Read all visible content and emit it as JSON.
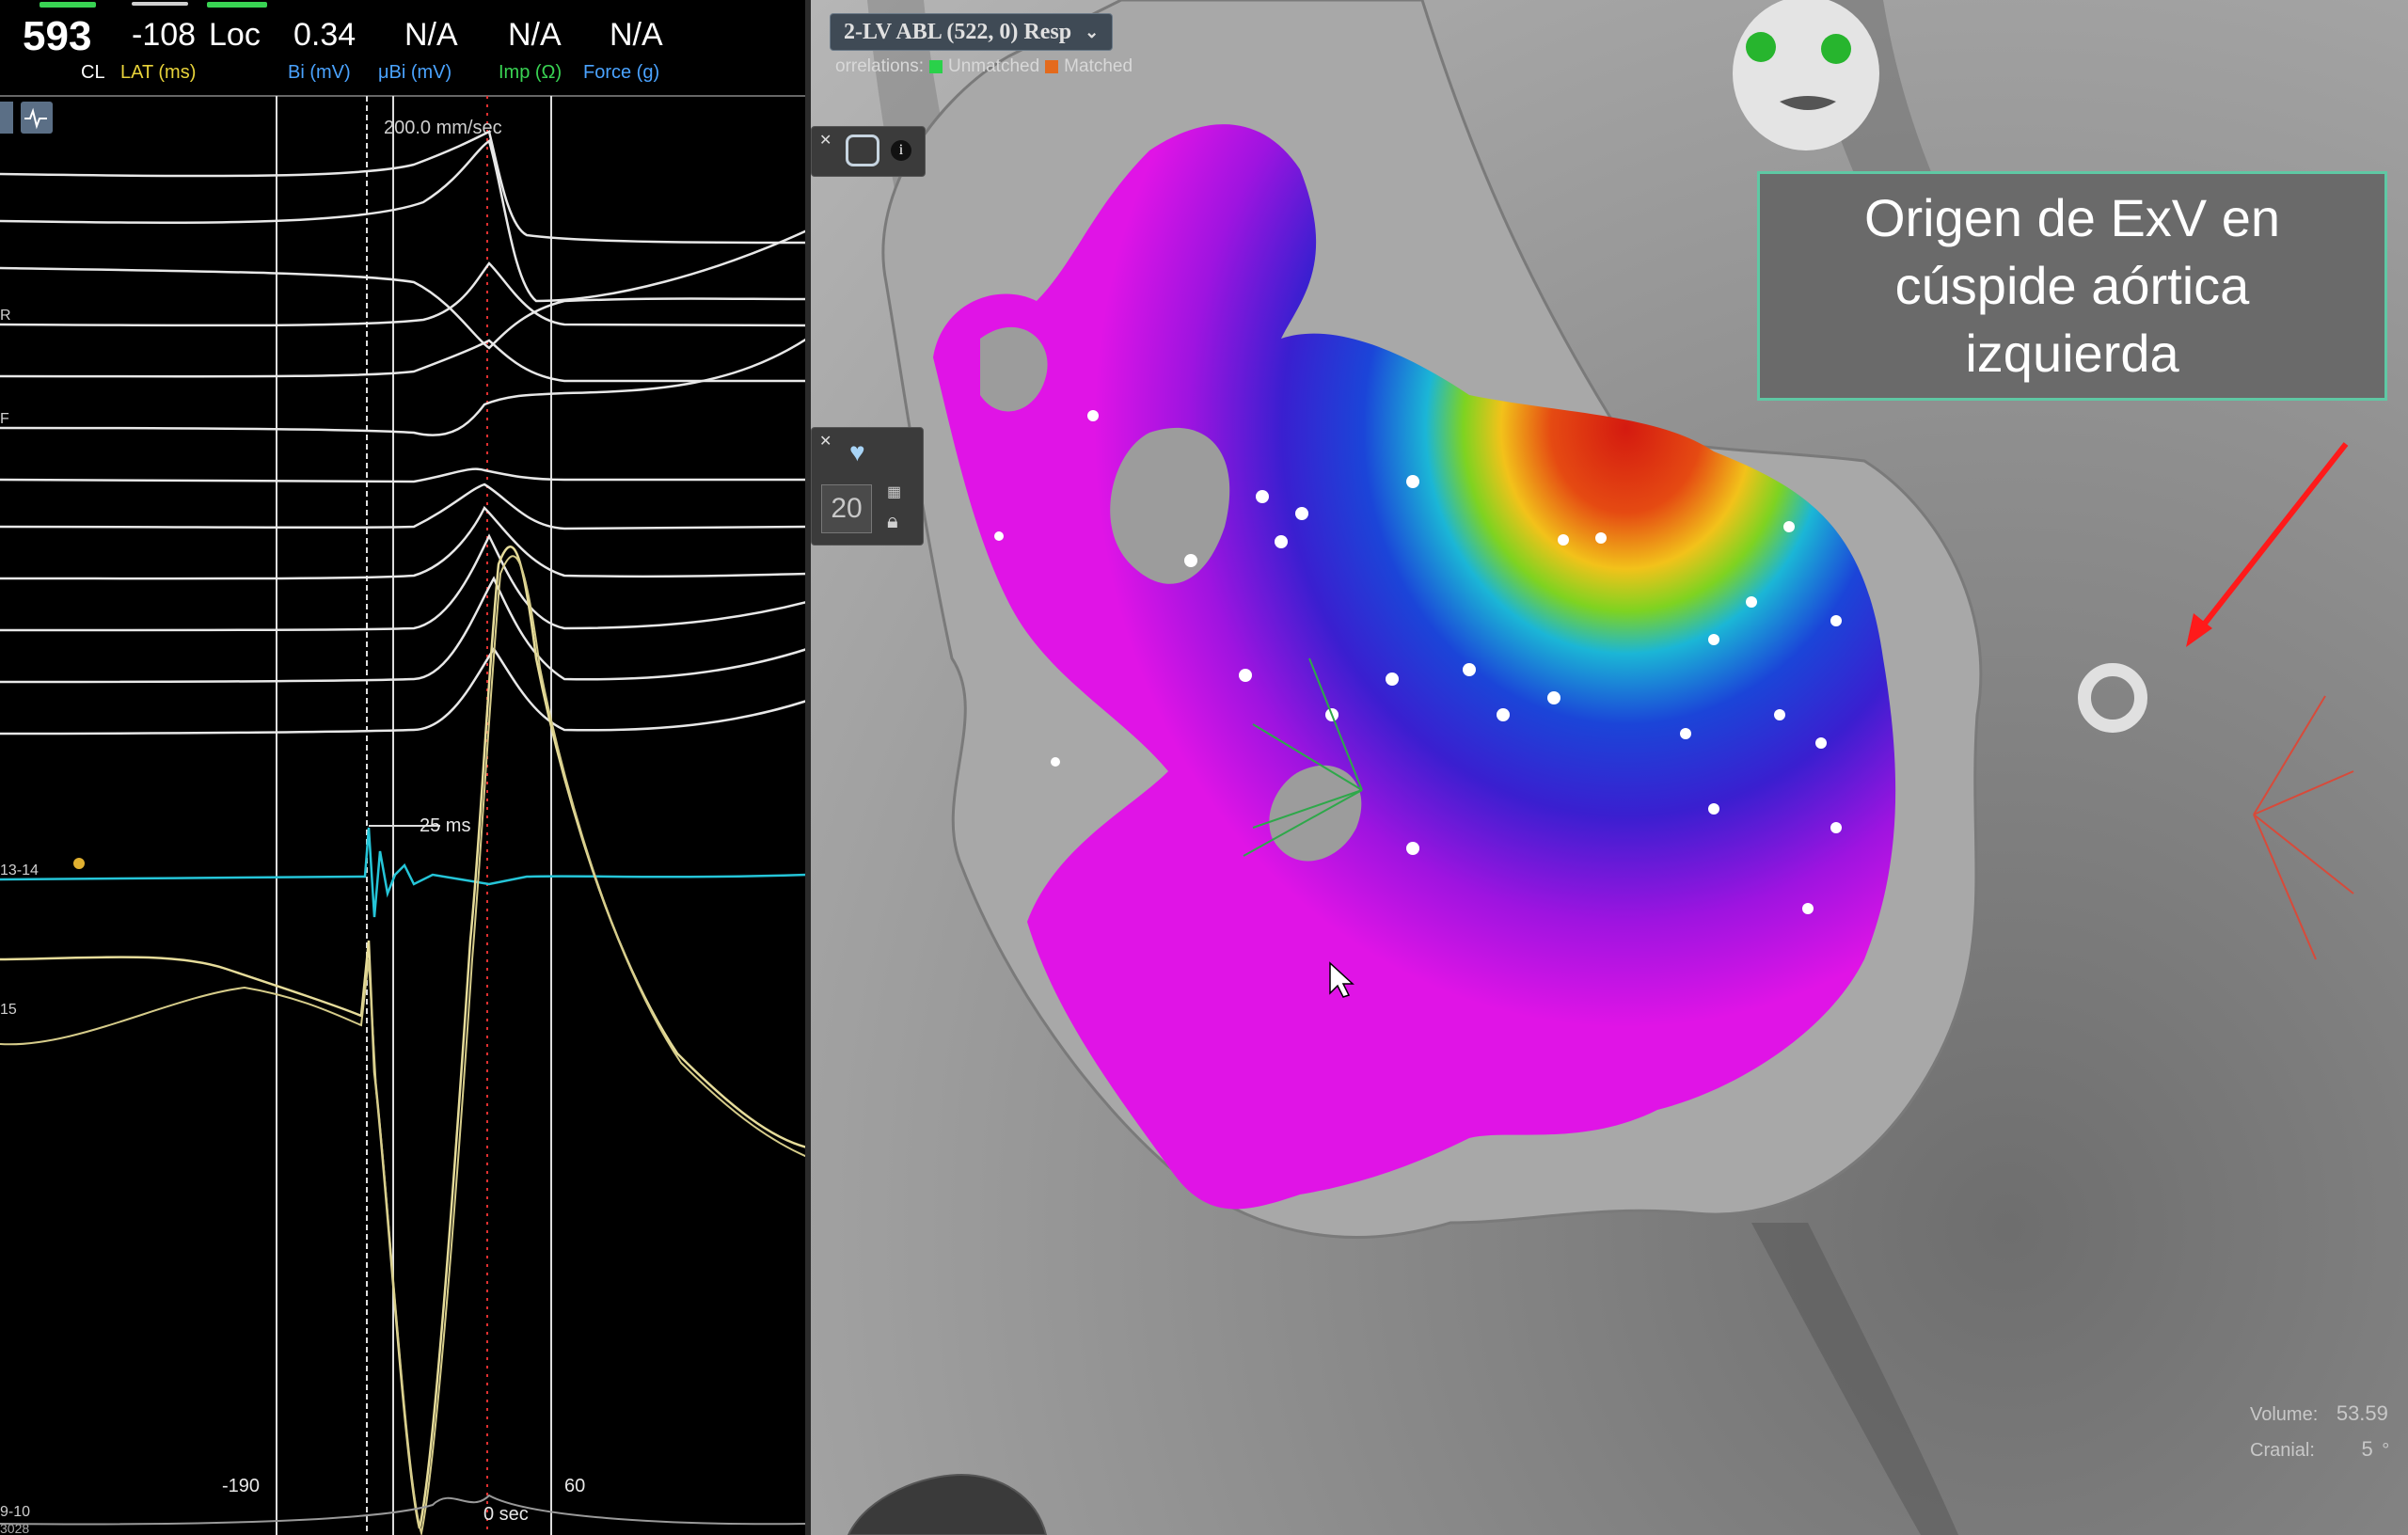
{
  "header": {
    "cl_value": "593",
    "cl_label": "CL",
    "lat_value": "-108",
    "lat_label": "LAT (ms)",
    "loc_value": "Loc",
    "bi_value": "0.34",
    "bi_label": "Bi (mV)",
    "ubi_value": "N/A",
    "ubi_label": "μBi (mV)",
    "imp_value": "N/A",
    "imp_label": "Imp (Ω)",
    "force_value": "N/A",
    "force_label": "Force (g)"
  },
  "traces": {
    "sweep_speed": "200.0 mm/sec",
    "interval_label": "25 ms",
    "channel_labels": [
      "R",
      "F",
      "13-14",
      "15",
      "9-10",
      "3028"
    ],
    "time_ticks": [
      "-190",
      "0 sec",
      "60"
    ]
  },
  "map": {
    "map_selector": "2-LV ABL (522, 0) Resp",
    "correlations_label": "orrelations:",
    "unmatched_label": "Unmatched",
    "matched_label": "Matched",
    "counter_value": "20",
    "volume_label": "Volume:",
    "volume_value": "53.59",
    "cranial_label": "Cranial:",
    "cranial_value": "5",
    "cranial_unit": "°",
    "annotation_line1": "Origen de  ExV en",
    "annotation_line2": "cúspide aórtica",
    "annotation_line3": "izquierda"
  },
  "colors": {
    "header_yellow": "#e8d33a",
    "header_blue": "#4aa3ff",
    "header_green": "#39d353",
    "trace_white": "#e8e8e8",
    "trace_cyan": "#25c5d8",
    "trace_yellow": "#e6dc9a",
    "annotation_border": "#5fc8a4",
    "arrow_red": "#ff1a1a",
    "map_magenta": "#e014e6"
  }
}
